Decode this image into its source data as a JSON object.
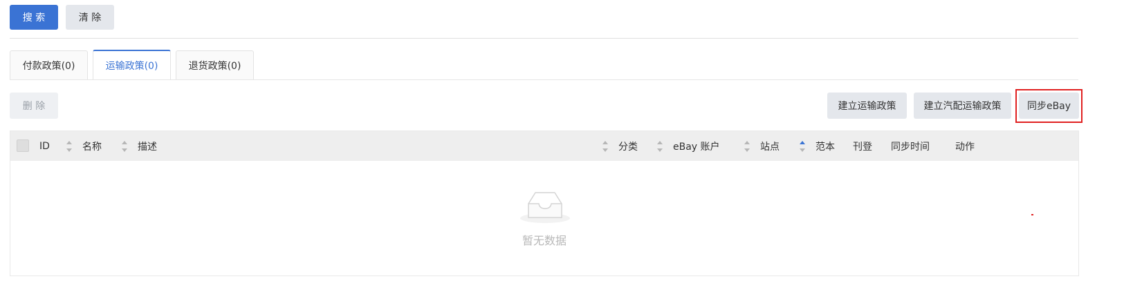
{
  "toolbar": {
    "search_label": "搜 索",
    "clear_label": "清 除"
  },
  "tabs": [
    {
      "label": "付款政策(0)",
      "active": false
    },
    {
      "label": "运输政策(0)",
      "active": true
    },
    {
      "label": "退货政策(0)",
      "active": false
    }
  ],
  "actions": {
    "delete_label": "删 除",
    "create_shipping_label": "建立运输政策",
    "create_motor_shipping_label": "建立汽配运输政策",
    "sync_ebay_label": "同步eBay"
  },
  "table": {
    "columns": {
      "id": "ID",
      "name": "名称",
      "description": "描述",
      "category": "分类",
      "ebay_account": "eBay 账户",
      "site": "站点",
      "template": "范本",
      "listing": "刊登",
      "sync_time": "同步时间",
      "action": "动作"
    },
    "rows": [],
    "empty_text": "暂无数据"
  },
  "colors": {
    "primary": "#3a73d4",
    "highlight": "#e02020"
  }
}
